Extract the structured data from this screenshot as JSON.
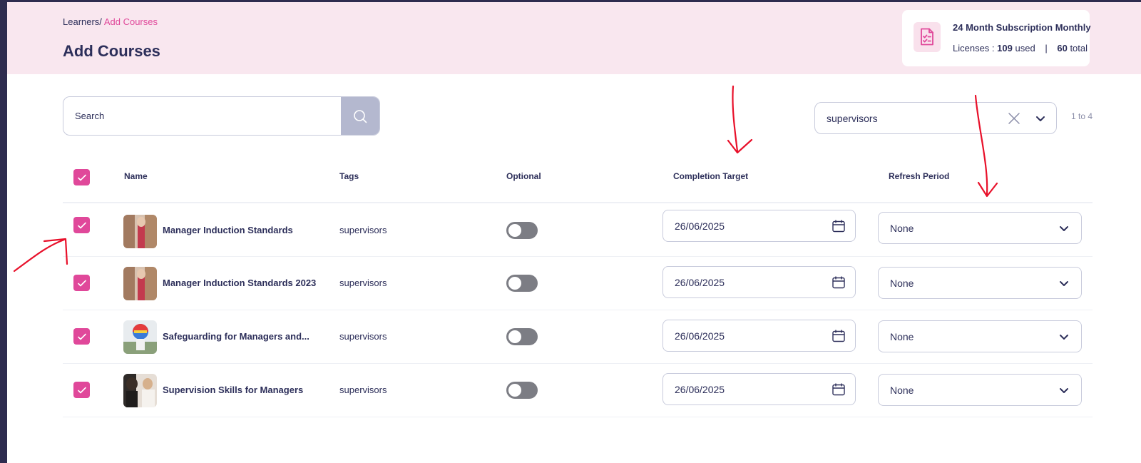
{
  "breadcrumb": {
    "parent": "Learners/",
    "current": "Add Courses"
  },
  "page_title": "Add Courses",
  "subscription": {
    "name": "24 Month Subscription Monthly",
    "licenses_label": "Licenses :",
    "used_count": "109",
    "used_label": "used",
    "separator": "|",
    "total_count": "60",
    "total_label": "total",
    "icon": "checklist-document-icon"
  },
  "search": {
    "placeholder": "Search",
    "icon": "search-icon"
  },
  "tag_filter": {
    "value": "supervisors",
    "clear_icon": "close-icon",
    "chevron_icon": "chevron-down-icon"
  },
  "pager": {
    "text": "1 to 4"
  },
  "table": {
    "headers": {
      "name": "Name",
      "tags": "Tags",
      "optional": "Optional",
      "completion_target": "Completion Target",
      "refresh_period": "Refresh Period"
    },
    "select_all_checked": true,
    "rows": [
      {
        "checked": true,
        "name": "Manager Induction Standards",
        "tag": "supervisors",
        "optional": false,
        "completion_target": "26/06/2025",
        "refresh_period": "None"
      },
      {
        "checked": true,
        "name": "Manager Induction Standards 2023",
        "tag": "supervisors",
        "optional": false,
        "completion_target": "26/06/2025",
        "refresh_period": "None"
      },
      {
        "checked": true,
        "name": "Safeguarding for Managers and...",
        "tag": "supervisors",
        "optional": false,
        "completion_target": "26/06/2025",
        "refresh_period": "None"
      },
      {
        "checked": true,
        "name": "Supervision Skills for Managers",
        "tag": "supervisors",
        "optional": false,
        "completion_target": "26/06/2025",
        "refresh_period": "None"
      }
    ]
  },
  "colors": {
    "accent_pink": "#e0489a",
    "header_bg": "#f9e7ef",
    "text_dark": "#2d2f5a",
    "annotation_red": "#e8102a"
  }
}
